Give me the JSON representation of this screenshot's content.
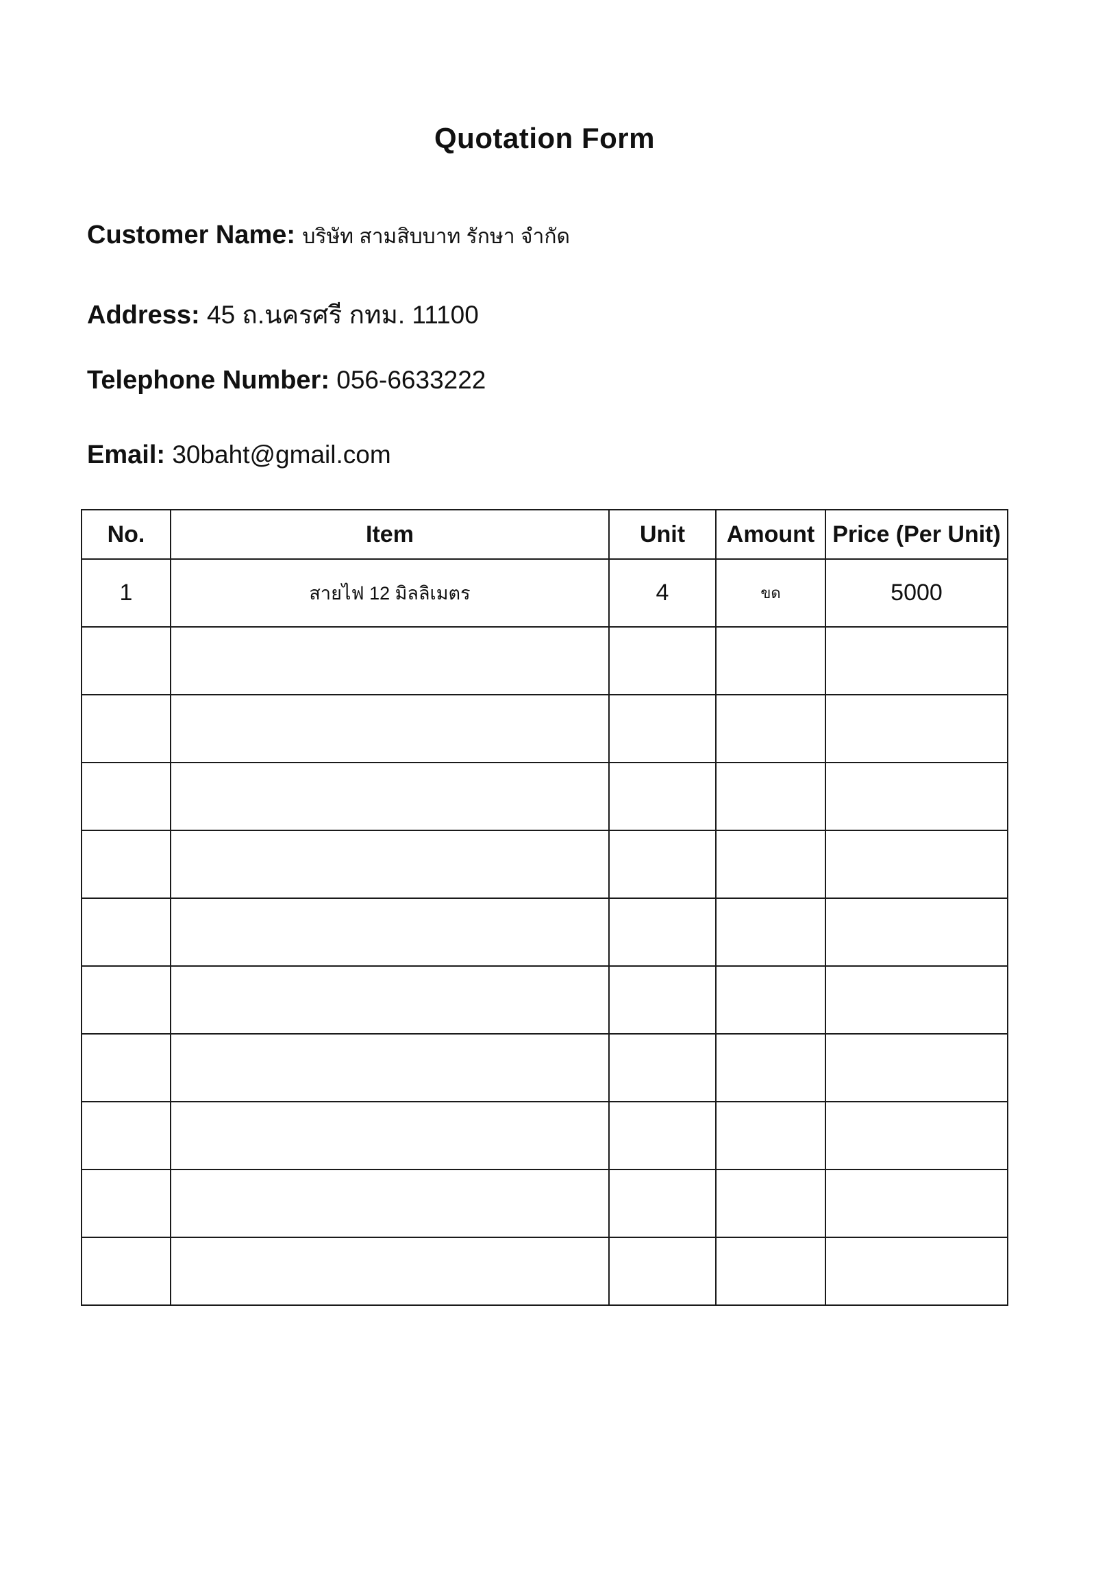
{
  "form": {
    "title": "Quotation Form",
    "customer_label": "Customer Name:",
    "customer_value": "บริษัท สามสิบบาท รักษา จำกัด",
    "address_label": "Address:",
    "address_value": "45 ถ.นครศรี กทม. 11100",
    "phone_label": "Telephone Number:",
    "phone_value": "056-6633222",
    "email_label": "Email:",
    "email_value": "30baht@gmail.com"
  },
  "table": {
    "headers": [
      "No.",
      "Item",
      "Unit",
      "Amount",
      "Price (Per Unit)"
    ],
    "rows": [
      [
        "1",
        "สายไฟ 12 มิลลิเมตร",
        "4",
        "ขด",
        "5000"
      ],
      [
        "",
        "",
        "",
        "",
        ""
      ],
      [
        "",
        "",
        "",
        "",
        ""
      ],
      [
        "",
        "",
        "",
        "",
        ""
      ],
      [
        "",
        "",
        "",
        "",
        ""
      ],
      [
        "",
        "",
        "",
        "",
        ""
      ],
      [
        "",
        "",
        "",
        "",
        ""
      ],
      [
        "",
        "",
        "",
        "",
        ""
      ],
      [
        "",
        "",
        "",
        "",
        ""
      ],
      [
        "",
        "",
        "",
        "",
        ""
      ],
      [
        "",
        "",
        "",
        "",
        ""
      ]
    ]
  }
}
